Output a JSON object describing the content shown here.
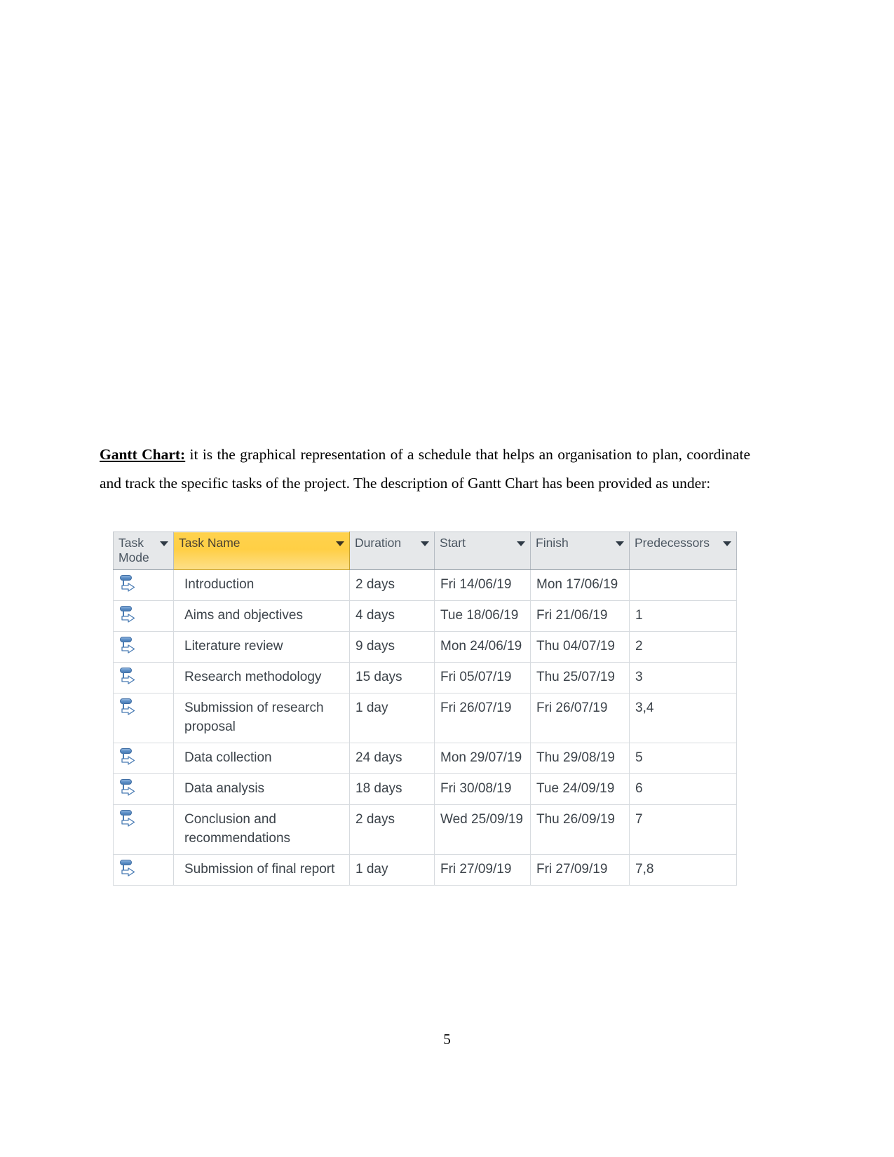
{
  "document": {
    "page_number": "5",
    "paragraph": {
      "lead": "Gantt Chart:",
      "text": " it is the graphical representation of a schedule that helps an organisation to plan, coordinate and track the specific tasks of the project. The description of Gantt Chart has been provided as under:"
    }
  },
  "gantt_table": {
    "columns": [
      {
        "key": "mode",
        "label": "Task\nMode",
        "has_dropdown": true,
        "highlighted": false,
        "dropdown_icon": "chevron-down-icon"
      },
      {
        "key": "name",
        "label": "Task Name",
        "has_dropdown": true,
        "highlighted": true,
        "dropdown_icon": "chevron-down-icon"
      },
      {
        "key": "duration",
        "label": "Duration",
        "has_dropdown": true,
        "highlighted": false,
        "dropdown_icon": "chevron-down-icon"
      },
      {
        "key": "start",
        "label": "Start",
        "has_dropdown": true,
        "highlighted": false,
        "dropdown_icon": "chevron-down-icon"
      },
      {
        "key": "finish",
        "label": "Finish",
        "has_dropdown": true,
        "highlighted": false,
        "dropdown_icon": "chevron-down-icon"
      },
      {
        "key": "predecessors",
        "label": "Predecessors",
        "has_dropdown": true,
        "highlighted": false,
        "dropdown_icon": "chevron-down-icon"
      }
    ],
    "highlight_color": "#ffd24d",
    "header_color": "#e6e8ea",
    "task_mode_icon": "auto-scheduled-icon",
    "rows": [
      {
        "mode_icon": "auto-scheduled-icon",
        "name": "Introduction",
        "duration": "2 days",
        "start": "Fri 14/06/19",
        "finish": "Mon 17/06/19",
        "predecessors": ""
      },
      {
        "mode_icon": "auto-scheduled-icon",
        "name": "Aims and objectives",
        "duration": "4 days",
        "start": "Tue 18/06/19",
        "finish": "Fri 21/06/19",
        "predecessors": "1"
      },
      {
        "mode_icon": "auto-scheduled-icon",
        "name": "Literature review",
        "duration": "9 days",
        "start": "Mon 24/06/19",
        "finish": "Thu 04/07/19",
        "predecessors": "2"
      },
      {
        "mode_icon": "auto-scheduled-icon",
        "name": "Research methodology",
        "duration": "15 days",
        "start": "Fri 05/07/19",
        "finish": "Thu 25/07/19",
        "predecessors": "3"
      },
      {
        "mode_icon": "auto-scheduled-icon",
        "name": "Submission of research proposal",
        "duration": "1 day",
        "start": "Fri 26/07/19",
        "finish": "Fri 26/07/19",
        "predecessors": "3,4"
      },
      {
        "mode_icon": "auto-scheduled-icon",
        "name": "Data collection",
        "duration": "24 days",
        "start": "Mon 29/07/19",
        "finish": "Thu 29/08/19",
        "predecessors": "5"
      },
      {
        "mode_icon": "auto-scheduled-icon",
        "name": "Data analysis",
        "duration": "18 days",
        "start": "Fri 30/08/19",
        "finish": "Tue 24/09/19",
        "predecessors": "6"
      },
      {
        "mode_icon": "auto-scheduled-icon",
        "name": "Conclusion and recommendations",
        "duration": "2 days",
        "start": "Wed 25/09/19",
        "finish": "Thu 26/09/19",
        "predecessors": "7"
      },
      {
        "mode_icon": "auto-scheduled-icon",
        "name": "Submission of final report",
        "duration": "1 day",
        "start": "Fri 27/09/19",
        "finish": "Fri 27/09/19",
        "predecessors": "7,8"
      }
    ]
  }
}
